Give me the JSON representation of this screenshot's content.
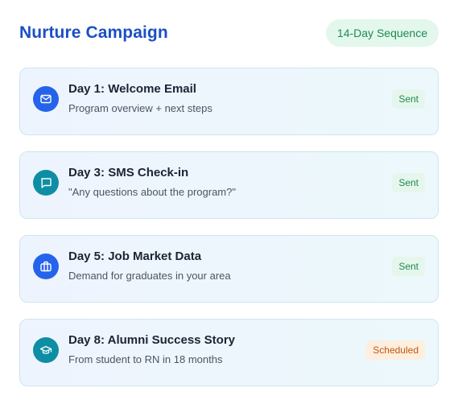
{
  "header": {
    "title": "Nurture Campaign",
    "sequence_badge": "14-Day Sequence"
  },
  "steps": [
    {
      "title": "Day 1: Welcome Email",
      "subtitle": "Program overview + next steps",
      "status": "Sent",
      "icon": "mail-icon",
      "icon_color": "#2563eb"
    },
    {
      "title": "Day 3: SMS Check-in",
      "subtitle": "\"Any questions about the program?\"",
      "status": "Sent",
      "icon": "chat-icon",
      "icon_color": "#0e8ea4"
    },
    {
      "title": "Day 5: Job Market Data",
      "subtitle": "Demand for graduates in your area",
      "status": "Sent",
      "icon": "briefcase-icon",
      "icon_color": "#2563eb"
    },
    {
      "title": "Day 8: Alumni Success Story",
      "subtitle": "From student to RN in 18 months",
      "status": "Scheduled",
      "icon": "graduation-cap-icon",
      "icon_color": "#0e8ea4"
    }
  ],
  "colors": {
    "title": "#1b4fc4",
    "sent": "#1f8a52",
    "scheduled": "#c2580f"
  }
}
